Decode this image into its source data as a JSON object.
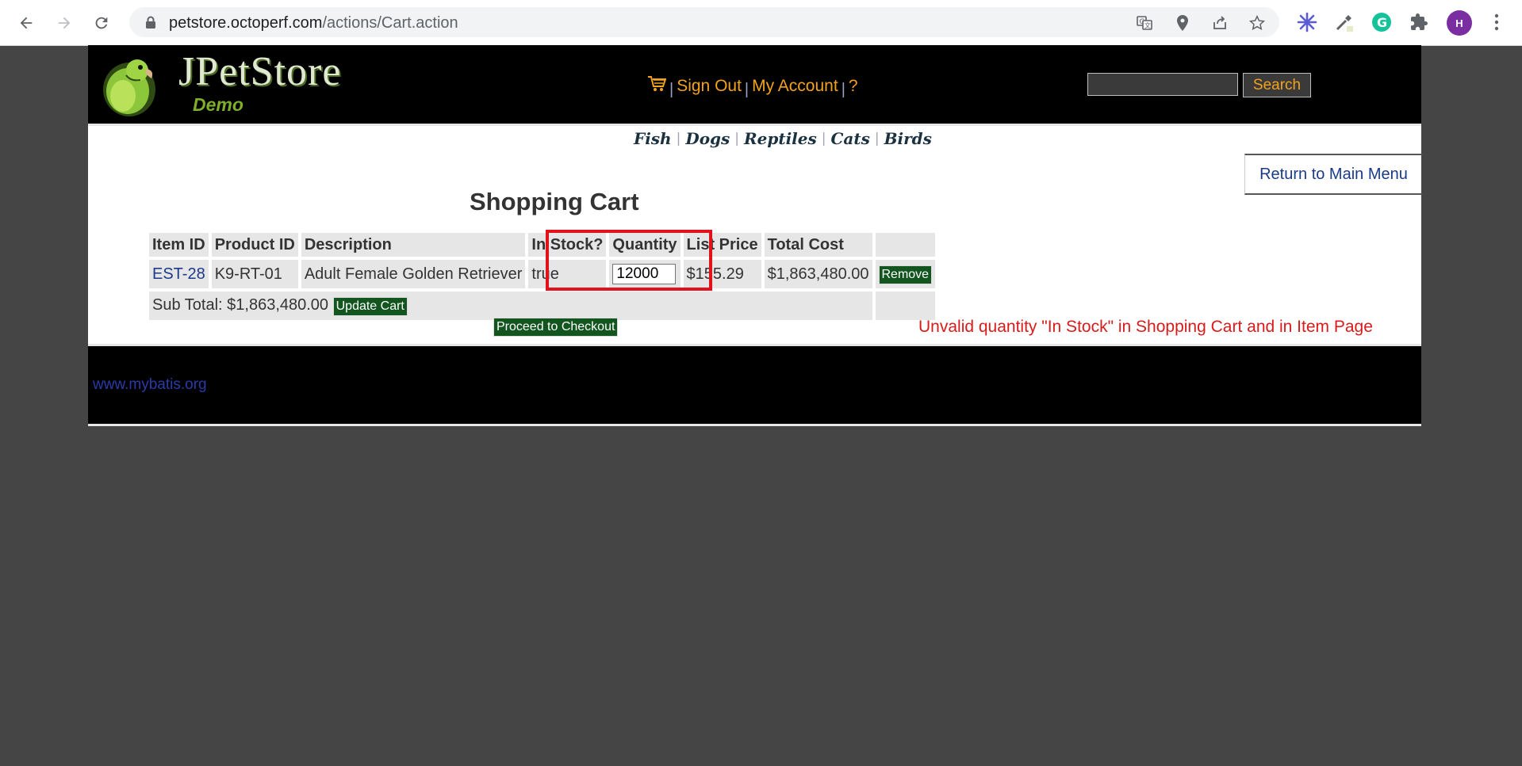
{
  "browser": {
    "url_host": "petstore.octoperf.com",
    "url_path": "/actions/Cart.action",
    "avatar_initial": "H"
  },
  "header": {
    "logo_title": "JPetStore",
    "logo_subtitle": "Demo",
    "menu": {
      "sign_out": "Sign Out",
      "my_account": "My Account",
      "help": "?"
    },
    "search_placeholder": "",
    "search_button": "Search"
  },
  "quicklinks": [
    "Fish",
    "Dogs",
    "Reptiles",
    "Cats",
    "Birds"
  ],
  "return_link": "Return to Main Menu",
  "cart": {
    "title": "Shopping Cart",
    "columns": [
      "Item ID",
      "Product ID",
      "Description",
      "In Stock?",
      "Quantity",
      "List Price",
      "Total Cost"
    ],
    "rows": [
      {
        "item_id": "EST-28",
        "product_id": "K9-RT-01",
        "description": "Adult Female Golden Retriever",
        "in_stock": "true",
        "quantity": "12000",
        "list_price": "$155.29",
        "total_cost": "$1,863,480.00",
        "remove_label": "Remove"
      }
    ],
    "subtotal_label": "Sub Total: $1,863,480.00",
    "update_button": "Update Cart",
    "checkout_button": "Proceed to Checkout"
  },
  "annotation": "Unvalid quantity \"In Stock\" in Shopping Cart and in Item Page",
  "footer": {
    "link": "www.mybatis.org"
  },
  "colors": {
    "page_bg": "#454545",
    "header_bg": "#000000",
    "menu_orange": "#f3a21e",
    "button_green": "#12551f",
    "highlight_red": "#e3111b"
  }
}
